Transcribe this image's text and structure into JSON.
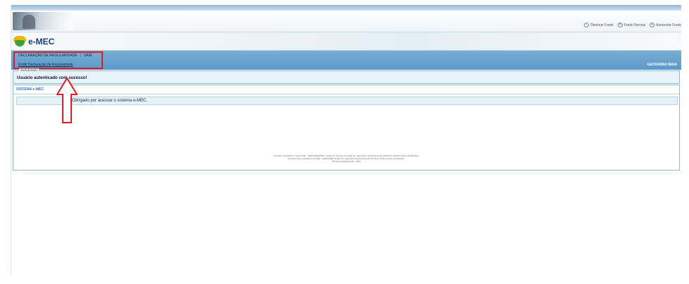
{
  "header": {
    "font_tools": [
      {
        "icon": "minus-icon",
        "glyph": "-",
        "label": "Diminuir Fonte"
      },
      {
        "icon": "normal-icon",
        "glyph": "=",
        "label": "Fonte Normal"
      },
      {
        "icon": "plus-icon",
        "glyph": "+",
        "label": "Aumentar Fonte"
      }
    ]
  },
  "logo": {
    "text": "e-MEC"
  },
  "menu": {
    "declaracao": "DECLARAÇÃO DE REGULARIDADE",
    "separator": "|",
    "sair": "SAIR",
    "sub_link": "Emitir Declaração de Regularidade",
    "user": "GEOVANNA MAIA"
  },
  "success": {
    "legend": "SUCESSO",
    "message": "Usuário autenticado com sucesso!"
  },
  "panel": {
    "title": "SISTEMA e-MEC",
    "message": "Obrigado por acessar o sistema e-MEC."
  },
  "footer": {
    "lines": [
      "Contatos: Regulação e Supervisão - SRES/SESu/MEC, Seção 01, Acesso ao Seção 01, Segunda a Sexta-Feira das 08:00h às 20:00h (horário de Brasília).",
      "Dúvidas sobre avaliações do INEP - DAES/INEP, Seção 04, Segunda a Sexta-Feira das 07:00 às 20:00 (horário de Brasília).",
      "Ministério da Educação - 2011"
    ]
  },
  "colors": {
    "highlight": "#e31b23",
    "menu": "#5b99c9",
    "logo_text": "#1a3c78"
  }
}
